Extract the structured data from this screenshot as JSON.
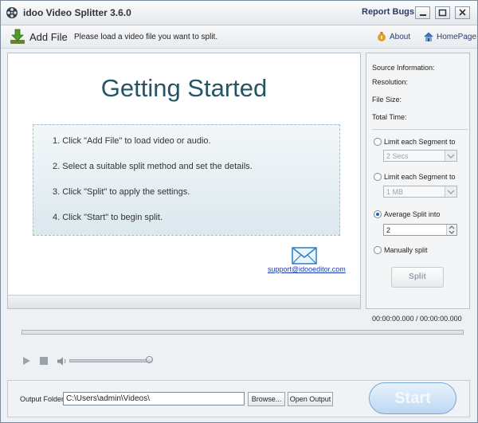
{
  "window": {
    "title": "idoo Video Splitter 3.6.0",
    "report_bugs": "Report Bugs"
  },
  "toolbar": {
    "add_file": "Add File",
    "hint": "Please load a video file you want to split.",
    "about": "About",
    "homepage": "HomePage"
  },
  "getting_started": {
    "title": "Getting Started",
    "steps": [
      "1. Click \"Add File\" to load video or audio.",
      "2. Select a suitable split method and set the details.",
      "3. Click \"Split\" to apply the settings.",
      "4. Click \"Start\" to begin split."
    ],
    "support_email": "support@idooeditor.com"
  },
  "info": {
    "source": "Source Information:",
    "resolution": "Resolution:",
    "file_size": "File Size:",
    "total_time": "Total Time:"
  },
  "split_options": {
    "limit_time_label": "Limit each Segment to",
    "limit_time_value": "2 Secs",
    "limit_size_label": "Limit each Segment to",
    "limit_size_value": "1 MB",
    "average_label": "Average Split into",
    "average_value": "2",
    "manual_label": "Manually split",
    "split_button": "Split",
    "selected": "average"
  },
  "player": {
    "timecode": "00:00:00.000 / 00:00:00.000"
  },
  "output": {
    "label": "Output Folder:",
    "path": "C:\\Users\\admin\\Videos\\",
    "browse": "Browse...",
    "open_output": "Open Output",
    "start": "Start"
  },
  "colors": {
    "accent": "#255563",
    "link": "#1a3bb5",
    "selected_radio": "#1b5fb3"
  }
}
